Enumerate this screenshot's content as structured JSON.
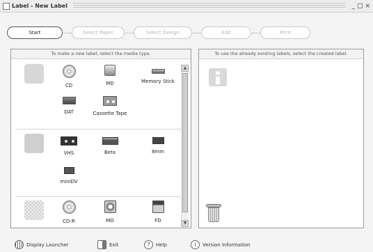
{
  "window": {
    "title": "Label - New Label",
    "controls": [
      "_",
      "□",
      "×"
    ]
  },
  "steps": [
    {
      "label": "Start",
      "active": true
    },
    {
      "label": "Select Paper",
      "active": false
    },
    {
      "label": "Select Design",
      "active": false
    },
    {
      "label": "Edit",
      "active": false
    },
    {
      "label": "Print",
      "active": false
    }
  ],
  "left_panel": {
    "instruction": "To make a new label, select the media type.",
    "groups": [
      {
        "category_icon": "music-category-icon",
        "items": [
          {
            "label": "CD",
            "icon": "cd-icon"
          },
          {
            "label": "MD",
            "icon": "md-icon"
          },
          {
            "label": "Memory Stick",
            "icon": "memory-stick-icon"
          },
          {
            "label": "DAT",
            "icon": "dat-icon"
          },
          {
            "label": "Cassette Tape",
            "icon": "cassette-tape-icon"
          }
        ]
      },
      {
        "category_icon": "video-category-icon",
        "items": [
          {
            "label": "VHS",
            "icon": "vhs-icon"
          },
          {
            "label": "Beta",
            "icon": "beta-icon"
          },
          {
            "label": "8mm",
            "icon": "8mm-icon"
          },
          {
            "label": "miniDV",
            "icon": "minidv-icon"
          }
        ]
      },
      {
        "category_icon": "data-category-icon",
        "items": [
          {
            "label": "CD-R",
            "icon": "cd-r-icon"
          },
          {
            "label": "MO",
            "icon": "mo-icon"
          },
          {
            "label": "FD",
            "icon": "fd-icon"
          }
        ]
      }
    ]
  },
  "right_panel": {
    "instruction": "To use the already existing labels, select the created label."
  },
  "bottom_bar": {
    "display_launcher": "Display Launcher",
    "exit": "Exit",
    "help": "Help",
    "version": "Version Information"
  }
}
